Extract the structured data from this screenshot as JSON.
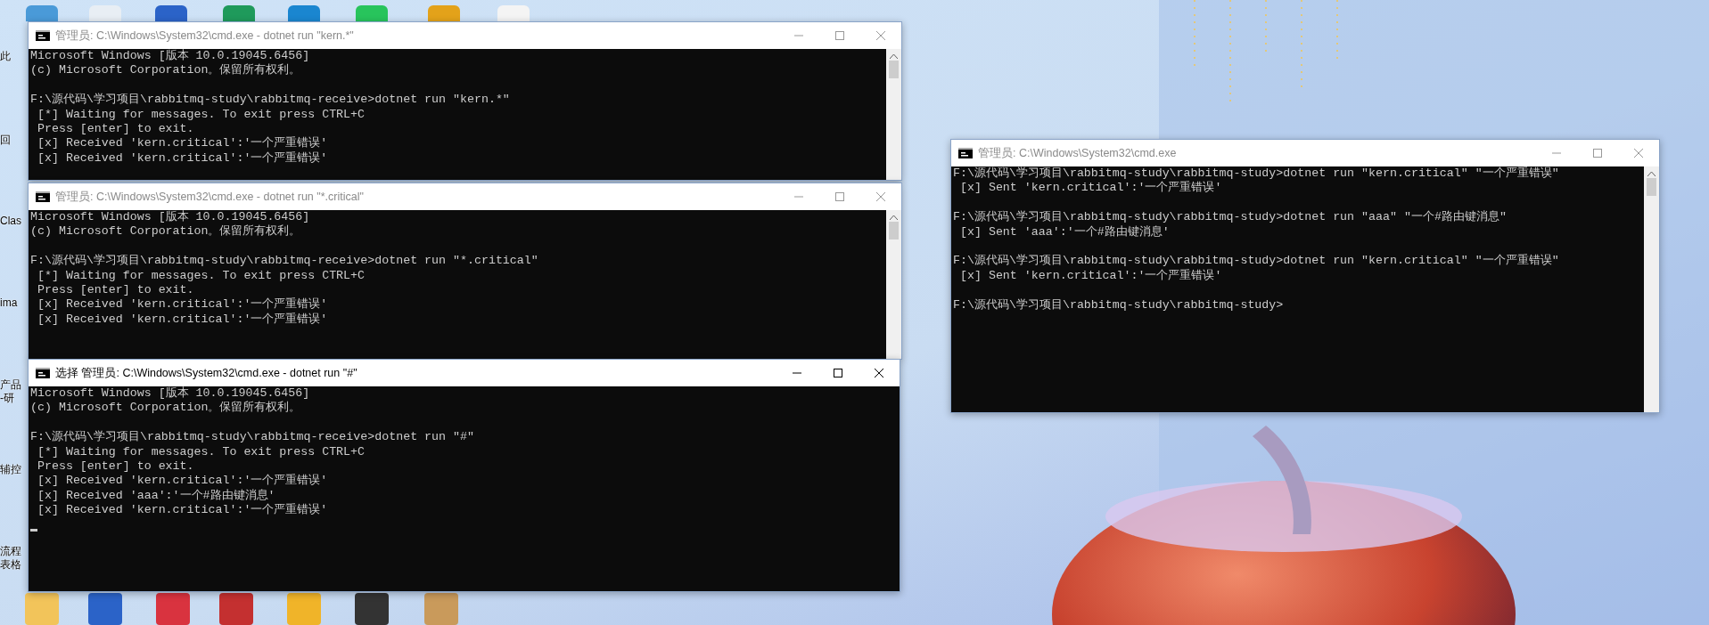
{
  "desktop_labels": [
    "此",
    "回",
    "Clas",
    "ima",
    "产品",
    "-研",
    "辅控",
    "流程",
    "表格"
  ],
  "windows": [
    {
      "title": "管理员: C:\\Windows\\System32\\cmd.exe - dotnet  run \"kern.*\"",
      "active": false,
      "scrollbar": true,
      "cursor": false,
      "blocks": [
        [
          "Microsoft Windows [版本 10.0.19045.6456]",
          "(c) Microsoft Corporation。保留所有权利。"
        ],
        [
          "F:\\源代码\\学习项目\\rabbitmq-study\\rabbitmq-receive>dotnet run \"kern.*\"",
          " [*] Waiting for messages. To exit press CTRL+C",
          " Press [enter] to exit.",
          " [x] Received 'kern.critical':'一个严重错误'",
          " [x] Received 'kern.critical':'一个严重错误'"
        ]
      ]
    },
    {
      "title": "管理员: C:\\Windows\\System32\\cmd.exe - dotnet  run \"*.critical\"",
      "active": false,
      "scrollbar": true,
      "cursor": false,
      "blocks": [
        [
          "Microsoft Windows [版本 10.0.19045.6456]",
          "(c) Microsoft Corporation。保留所有权利。"
        ],
        [
          "F:\\源代码\\学习项目\\rabbitmq-study\\rabbitmq-receive>dotnet run \"*.critical\"",
          " [*] Waiting for messages. To exit press CTRL+C",
          " Press [enter] to exit.",
          " [x] Received 'kern.critical':'一个严重错误'",
          " [x] Received 'kern.critical':'一个严重错误'"
        ]
      ]
    },
    {
      "title": "选择 管理员: C:\\Windows\\System32\\cmd.exe - dotnet  run \"#\"",
      "active": true,
      "scrollbar": false,
      "cursor": true,
      "blocks": [
        [
          "Microsoft Windows [版本 10.0.19045.6456]",
          "(c) Microsoft Corporation。保留所有权利。"
        ],
        [
          "F:\\源代码\\学习项目\\rabbitmq-study\\rabbitmq-receive>dotnet run \"#\"",
          " [*] Waiting for messages. To exit press CTRL+C",
          " Press [enter] to exit.",
          " [x] Received 'kern.critical':'一个严重错误'",
          " [x] Received 'aaa':'一个#路由键消息'",
          " [x] Received 'kern.critical':'一个严重错误'"
        ]
      ]
    },
    {
      "title": "管理员: C:\\Windows\\System32\\cmd.exe",
      "active": false,
      "scrollbar": true,
      "cursor": false,
      "blocks": [
        [
          "F:\\源代码\\学习项目\\rabbitmq-study\\rabbitmq-study>dotnet run \"kern.critical\" \"一个严重错误\"",
          " [x] Sent 'kern.critical':'一个严重错误'"
        ],
        [
          "F:\\源代码\\学习项目\\rabbitmq-study\\rabbitmq-study>dotnet run \"aaa\" \"一个#路由键消息\"",
          " [x] Sent 'aaa':'一个#路由键消息'"
        ],
        [
          "F:\\源代码\\学习项目\\rabbitmq-study\\rabbitmq-study>dotnet run \"kern.critical\" \"一个严重错误\"",
          " [x] Sent 'kern.critical':'一个严重错误'"
        ],
        [
          "F:\\源代码\\学习项目\\rabbitmq-study\\rabbitmq-study>"
        ]
      ]
    }
  ]
}
